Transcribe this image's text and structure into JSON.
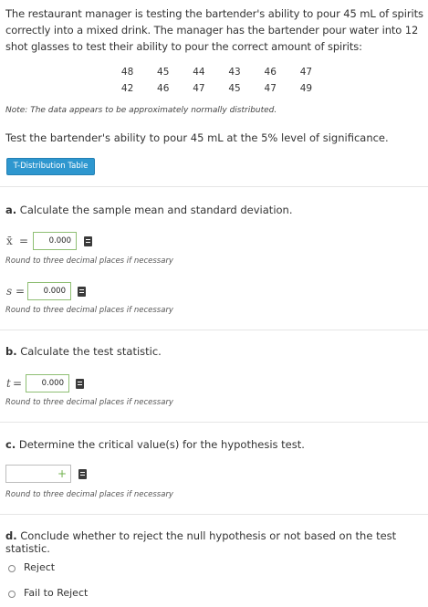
{
  "problem": {
    "text": "The restaurant manager is testing the bartender's ability to pour 45 mL of spirits correctly into a mixed drink. The manager has the bartender pour water into 12 shot glasses to test their ability to pour the correct amount of spirits:",
    "data_rows": [
      [
        "48",
        "45",
        "44",
        "43",
        "46",
        "47"
      ],
      [
        "42",
        "46",
        "47",
        "45",
        "47",
        "49"
      ]
    ],
    "note": "Note: The data appears to be approximately normally distributed.",
    "prompt": "Test the bartender's ability to pour 45 mL at the 5% level of significance.",
    "table_button": "T-Distribution Table"
  },
  "part_a": {
    "heading_letter": "a.",
    "heading": "Calculate the sample mean and standard deviation.",
    "mean_symbol": "x̄",
    "mean_eq": "=",
    "mean_value": "0.000",
    "mean_hint": "Round to three decimal places if necessary",
    "sd_symbol": "s",
    "sd_eq": "=",
    "sd_value": "0.000",
    "sd_hint": "Round to three decimal places if necessary"
  },
  "part_b": {
    "heading_letter": "b.",
    "heading": "Calculate the test statistic.",
    "t_symbol": "t",
    "t_eq": "=",
    "t_value": "0.000",
    "t_hint": "Round to three decimal places if necessary"
  },
  "part_c": {
    "heading_letter": "c.",
    "heading": "Determine the critical value(s) for the hypothesis test.",
    "plus": "+",
    "hint": "Round to three decimal places if necessary"
  },
  "part_d": {
    "heading_letter": "d.",
    "heading": "Conclude whether to reject the null hypothesis or not based on the test statistic.",
    "options": [
      "Reject",
      "Fail to Reject"
    ]
  },
  "icons": {
    "calculator": "calculator-icon",
    "radio": "radio-button-icon",
    "plus": "plus-icon"
  },
  "colors": {
    "button_bg": "#2e97cf",
    "field_border": "#8fbf74",
    "plus": "#6fb14b"
  }
}
